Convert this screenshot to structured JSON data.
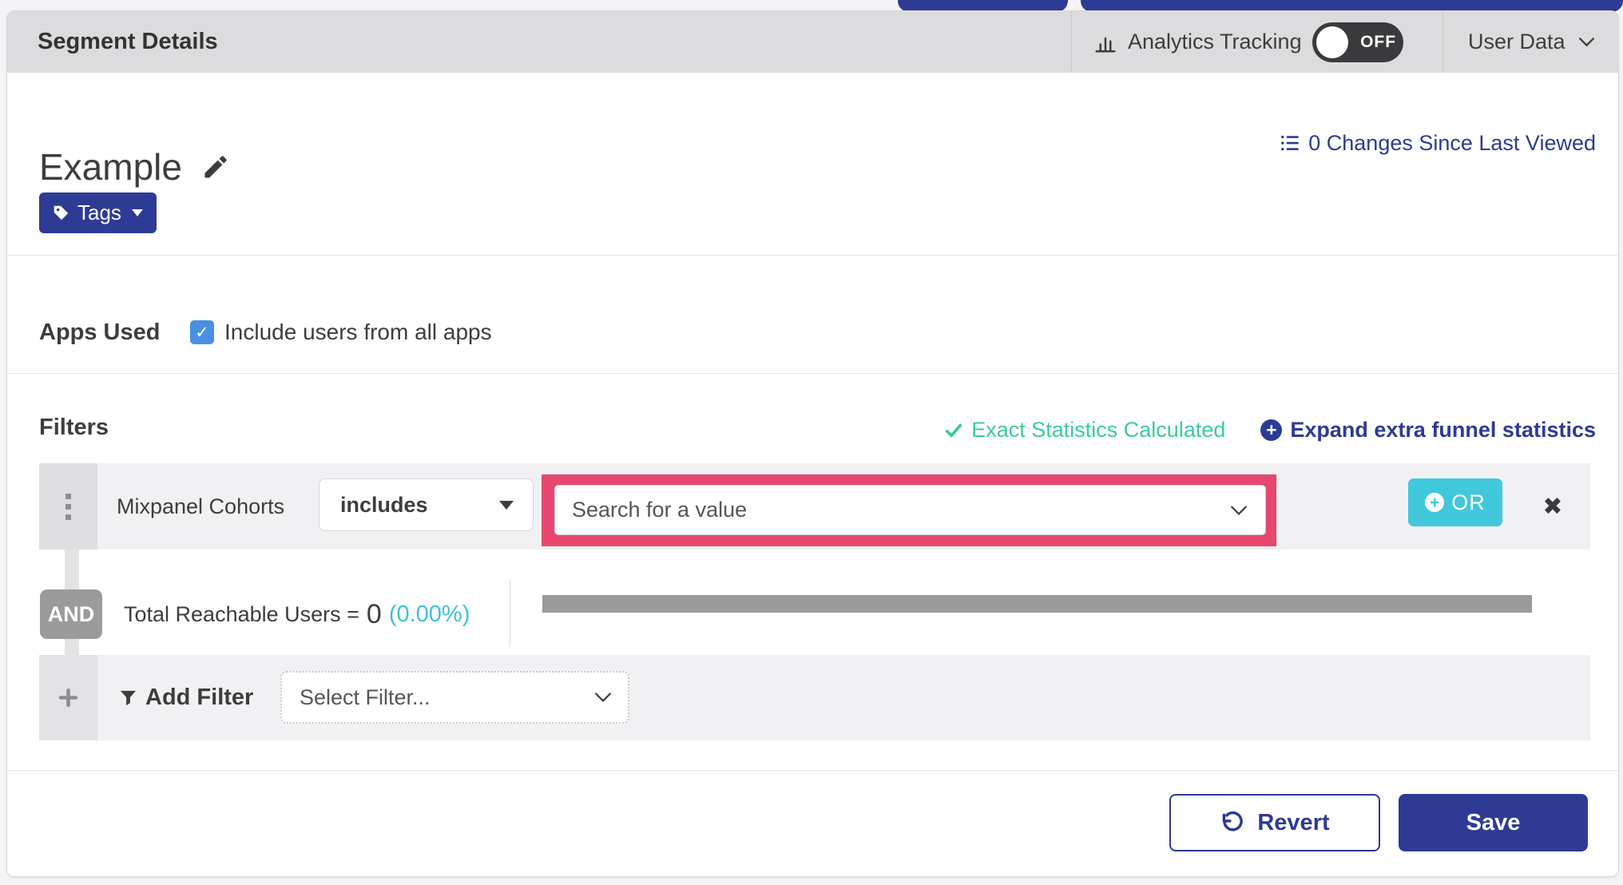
{
  "colors": {
    "indigo": "#2e3b94",
    "cyan": "#41c8dc",
    "teal": "#3fc9a4",
    "highlight_pink": "#e7476f",
    "checkbox_blue": "#4a90e2",
    "toggle_dark": "#3a3a3c",
    "badge_gray": "#9b9b9b"
  },
  "icons": {
    "analytics": "bar-chart",
    "changes": "list",
    "edit": "pencil",
    "tag": "tag",
    "checkbox_check": "✓",
    "exact_check": "check",
    "plus": "+",
    "drag_handle": "vertical-dots",
    "remove": "✖",
    "funnel": "funnel",
    "chevron": "chevron-down",
    "revert": "undo-arrow"
  },
  "header": {
    "title": "Segment Details",
    "analytics_tracking": {
      "label": "Analytics Tracking",
      "toggle": "OFF"
    },
    "user_data": {
      "label": "User Data"
    }
  },
  "segment": {
    "name": "Example",
    "tags_button": "Tags",
    "changes_link": "0 Changes Since Last Viewed"
  },
  "apps_used": {
    "label": "Apps Used",
    "include_all_apps": "Include users from all apps",
    "checked": true
  },
  "filters": {
    "heading": "Filters",
    "exact_statistics": "Exact Statistics Calculated",
    "expand_funnel": "Expand extra funnel statistics",
    "row": {
      "filter_name": "Mixpanel Cohorts",
      "operator": "includes",
      "value_placeholder": "Search for a value",
      "or_button": "OR"
    },
    "connector": "AND",
    "total_reachable": {
      "label": "Total Reachable Users =",
      "value": "0",
      "percent": "(0.00%)"
    },
    "add_filter": {
      "label": "Add Filter",
      "select_placeholder": "Select Filter..."
    }
  },
  "footer": {
    "revert": "Revert",
    "save": "Save"
  }
}
